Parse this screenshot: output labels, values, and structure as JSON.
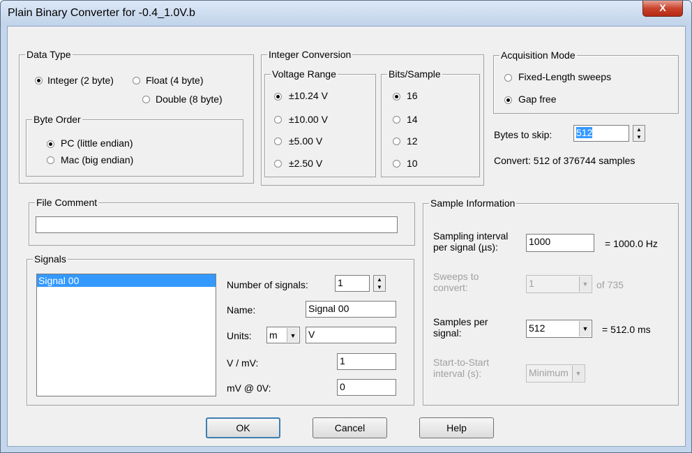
{
  "window": {
    "title": "Plain Binary Converter for -0.4_1.0V.b",
    "close_symbol": "X"
  },
  "data_type": {
    "legend": "Data Type",
    "integer": "Integer (2 byte)",
    "float": "Float (4 byte)",
    "double": "Double (8 byte)",
    "selected": "Integer (2 byte)",
    "byte_order": {
      "legend": "Byte Order",
      "pc": "PC (little endian)",
      "mac": "Mac (big endian)",
      "selected": "PC (little endian)"
    }
  },
  "integer_conversion": {
    "legend": "Integer Conversion",
    "voltage_range": {
      "legend": "Voltage Range",
      "options": [
        "±10.24 V",
        "±10.00 V",
        "±5.00 V",
        "±2.50 V"
      ],
      "selected": "±10.24 V"
    },
    "bits_sample": {
      "legend": "Bits/Sample",
      "options": [
        "16",
        "14",
        "12",
        "10"
      ],
      "selected": "16"
    }
  },
  "acquisition_mode": {
    "legend": "Acquisition Mode",
    "fixed_length": "Fixed-Length sweeps",
    "gap_free": "Gap free",
    "selected": "Gap free"
  },
  "bytes_to_skip": {
    "label": "Bytes to skip:",
    "value": "512"
  },
  "convert_status": "Convert: 512 of 376744 samples",
  "file_comment": {
    "legend": "File Comment",
    "value": ""
  },
  "signals": {
    "legend": "Signals",
    "list": [
      "Signal 00"
    ],
    "number_label": "Number of signals:",
    "number_value": "1",
    "name_label": "Name:",
    "name_value": "Signal 00",
    "units_label": "Units:",
    "units_prefix": "m",
    "units_value": "V",
    "scale_label": "V / mV:",
    "scale_value": "1",
    "offset_label": "mV @ 0V:",
    "offset_value": "0"
  },
  "sample_info": {
    "legend": "Sample Information",
    "interval_label_1": "Sampling interval",
    "interval_label_2": "per signal (µs):",
    "interval_value": "1000",
    "interval_result": "= 1000.0 Hz",
    "sweeps_label_1": "Sweeps to",
    "sweeps_label_2": "convert:",
    "sweeps_value": "1",
    "sweeps_of": "of 735",
    "samples_label_1": "Samples per",
    "samples_label_2": "signal:",
    "samples_value": "512",
    "samples_result": "= 512.0 ms",
    "s2s_label_1": "Start-to-Start",
    "s2s_label_2": "interval (s):",
    "s2s_value": "Minimum"
  },
  "buttons": {
    "ok": "OK",
    "cancel": "Cancel",
    "help": "Help"
  },
  "colors": {
    "selection": "#3399ff",
    "title_bar": "#c3d6ec",
    "close_button": "#c9432d"
  }
}
